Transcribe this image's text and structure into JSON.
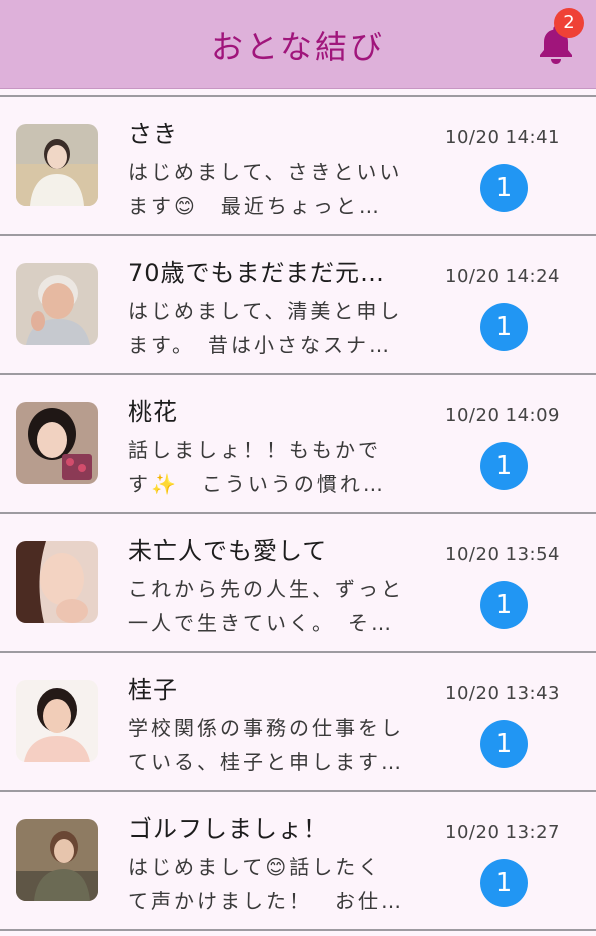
{
  "header": {
    "title": "おとな結び",
    "bell_icon": "bell-icon",
    "bell_color": "#a0157b",
    "notification_count": "2"
  },
  "colors": {
    "header_bg": "#deb1da",
    "title": "#a0157b",
    "badge_unread": "#2196f3",
    "badge_alert": "#ef4136",
    "list_bg": "#fdf4fb"
  },
  "conversations": [
    {
      "name": "さき",
      "preview_line1": "はじめまして、さきといい",
      "preview_line2": "ます😊　最近ちょっと…",
      "time": "10/20 14:41",
      "unread": "1",
      "avatar": "avatar-photo"
    },
    {
      "name": "70歳でもまだまだ元…",
      "preview_line1": "はじめまして、清美と申し",
      "preview_line2": "ます。　昔は小さなスナ…",
      "time": "10/20 14:24",
      "unread": "1",
      "avatar": "avatar-photo"
    },
    {
      "name": "桃花",
      "preview_line1": "話しましょ！！ももかで",
      "preview_line2": "す✨　こういうの慣れ…",
      "time": "10/20 14:09",
      "unread": "1",
      "avatar": "avatar-photo"
    },
    {
      "name": "未亡人でも愛して",
      "preview_line1": "これから先の人生、ずっと",
      "preview_line2": "一人で生きていく。　そ…",
      "time": "10/20 13:54",
      "unread": "1",
      "avatar": "avatar-photo"
    },
    {
      "name": "桂子",
      "preview_line1": "学校関係の事務の仕事をし",
      "preview_line2": "ている、桂子と申します…",
      "time": "10/20 13:43",
      "unread": "1",
      "avatar": "avatar-photo"
    },
    {
      "name": "ゴルフしましょ！",
      "preview_line1": "はじめまして😊話したく",
      "preview_line2": "て声かけました！　お仕…",
      "time": "10/20 13:27",
      "unread": "1",
      "avatar": "avatar-photo"
    }
  ]
}
